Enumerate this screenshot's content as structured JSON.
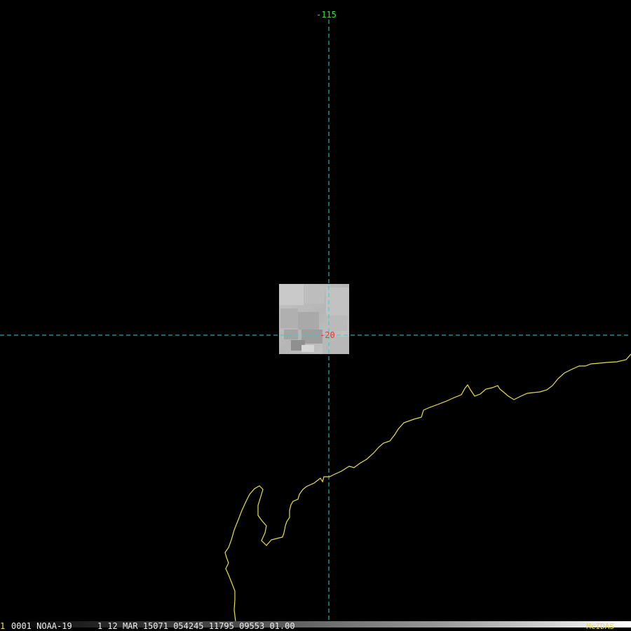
{
  "colors": {
    "graticule": "#30d0d0",
    "coastline": "#e8e040",
    "lon_label": "#30e030",
    "lat_label": "#ff3030",
    "status_text": "#f0f0f0",
    "frame_number": "#f0e040",
    "brand": "#f0e040"
  },
  "map": {
    "graticule": {
      "longitude_label": "-115",
      "latitude_label": "-20"
    },
    "image_patch": {
      "description_icon": "satellite-image-patch"
    }
  },
  "status_bar": {
    "frame_number": "1",
    "info": "0001 NOAA-19     1 12 MAR 15071 054245 11795 09553 01.00",
    "brand": "McIDAS"
  }
}
